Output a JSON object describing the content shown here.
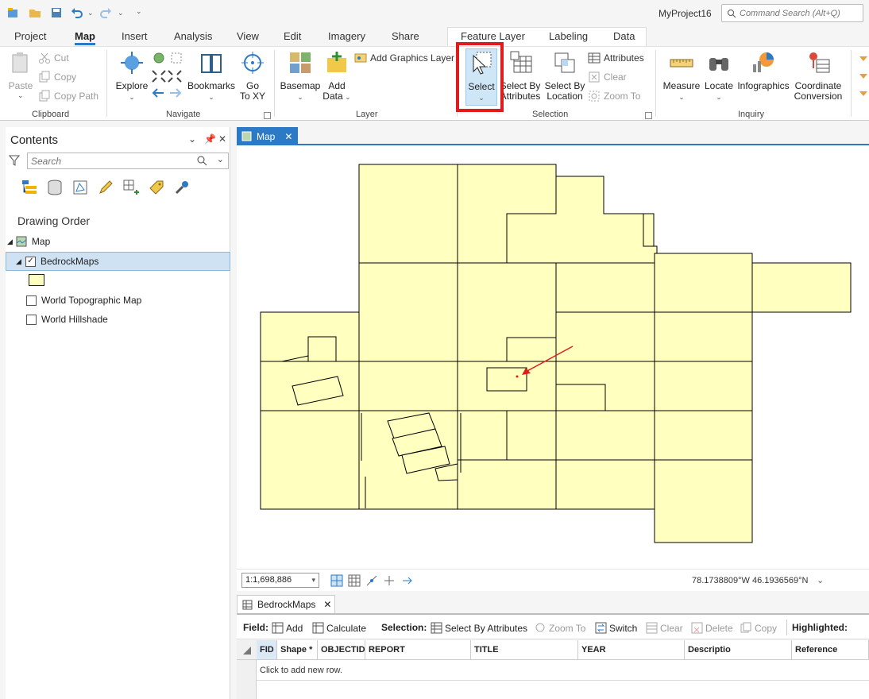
{
  "title_bar": {
    "project_name": "MyProject16",
    "command_search_placeholder": "Command Search (Alt+Q)"
  },
  "ribbon_tabs": [
    {
      "label": "Project"
    },
    {
      "label": "Map",
      "active": true
    },
    {
      "label": "Insert"
    },
    {
      "label": "Analysis"
    },
    {
      "label": "View"
    },
    {
      "label": "Edit"
    },
    {
      "label": "Imagery"
    },
    {
      "label": "Share"
    },
    {
      "label": "Feature Layer",
      "contextual": true
    },
    {
      "label": "Labeling",
      "contextual": true
    },
    {
      "label": "Data",
      "contextual": true
    }
  ],
  "ribbon": {
    "clipboard": {
      "group": "Clipboard",
      "paste": "Paste",
      "cut": "Cut",
      "copy": "Copy",
      "copy_path": "Copy Path"
    },
    "navigate": {
      "group": "Navigate",
      "explore": "Explore",
      "bookmarks": "Bookmarks",
      "go_to_xy_1": "Go",
      "go_to_xy_2": "To XY"
    },
    "layer": {
      "group": "Layer",
      "basemap": "Basemap",
      "add_data_1": "Add",
      "add_data_2": "Data",
      "add_graphics_layer": "Add Graphics Layer"
    },
    "selection": {
      "group": "Selection",
      "select": "Select",
      "select_by_attr_1": "Select By",
      "select_by_attr_2": "Attributes",
      "select_by_loc_1": "Select By",
      "select_by_loc_2": "Location",
      "attributes": "Attributes",
      "clear": "Clear",
      "zoom_to": "Zoom To"
    },
    "inquiry": {
      "group": "Inquiry",
      "measure": "Measure",
      "locate": "Locate",
      "infographics": "Infographics",
      "coord_conv_1": "Coordinate",
      "coord_conv_2": "Conversion"
    }
  },
  "contents": {
    "title": "Contents",
    "search_placeholder": "Search",
    "section": "Drawing Order",
    "map_node": "Map",
    "layers": [
      {
        "name": "BedrockMaps",
        "checked": true,
        "selected": true
      },
      {
        "name": "World Topographic Map",
        "checked": false
      },
      {
        "name": "World Hillshade",
        "checked": false
      }
    ]
  },
  "map_view": {
    "tab_label": "Map",
    "scale": "1:1,698,886",
    "coordinates": "78.1738809°W 46.1936569°N"
  },
  "attribute_table": {
    "tab_label": "BedrockMaps",
    "field_label": "Field:",
    "add": "Add",
    "calculate": "Calculate",
    "selection_label": "Selection:",
    "select_by_attributes": "Select By Attributes",
    "zoom_to": "Zoom To",
    "switch": "Switch",
    "clear": "Clear",
    "delete": "Delete",
    "copy": "Copy",
    "highlighted_label": "Highlighted:",
    "columns": [
      "FID",
      "Shape *",
      "OBJECTID",
      "REPORT",
      "TITLE",
      "YEAR",
      "Descriptio",
      "Reference"
    ],
    "new_row_hint": "Click to add new row."
  },
  "colors": {
    "accent": "#2c7ac6",
    "polygon_fill": "#ffffc0",
    "highlight_box": "#e01b1b"
  }
}
